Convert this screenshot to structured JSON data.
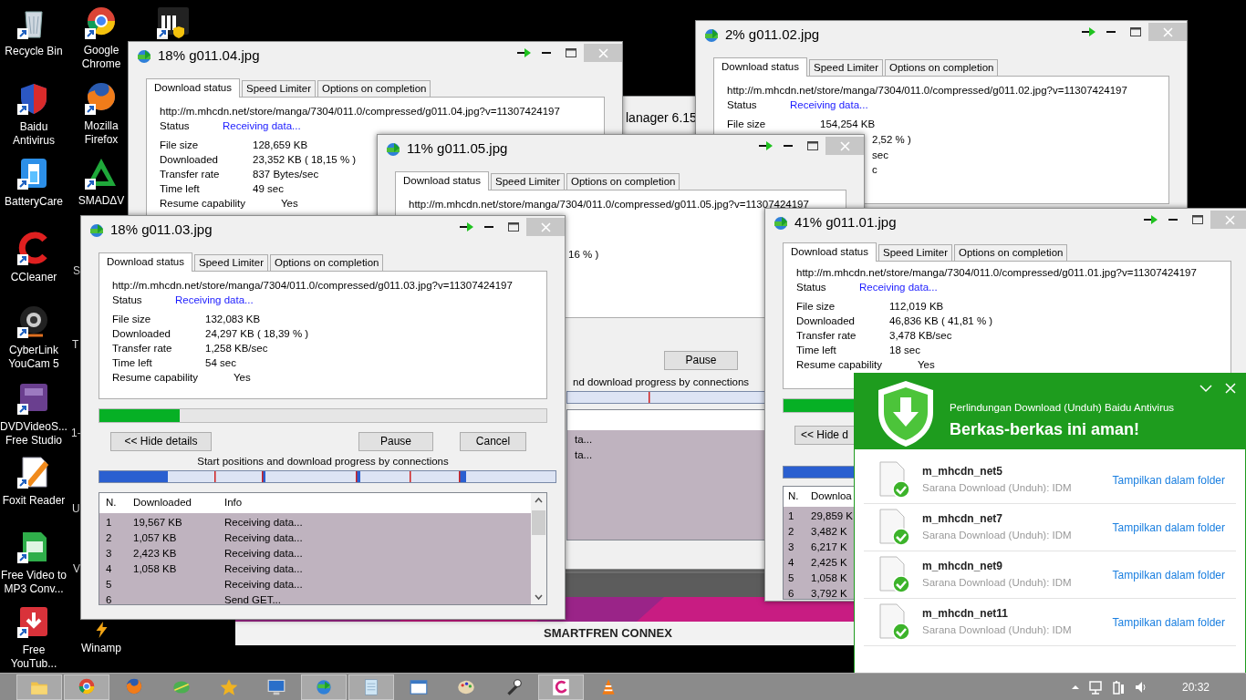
{
  "desktop_icons": [
    {
      "label": "Recycle Bin",
      "kind": "bin"
    },
    {
      "label": "Google Chrome",
      "kind": "chrome"
    },
    {
      "kind": "eop"
    },
    {
      "label": "Baidu Antivirus",
      "kind": "shield"
    },
    {
      "label": "Mozilla Firefox",
      "kind": "firefox"
    },
    {
      "label": "BatteryCare",
      "kind": "battery"
    },
    {
      "label": "SMADΔV",
      "kind": "triangle"
    },
    {
      "label": "CCleaner",
      "kind": "ccleaner"
    },
    {
      "label": "S",
      "kind": "partial"
    },
    {
      "label": "CyberLink YouCam 5",
      "kind": "webcam"
    },
    {
      "label": "T",
      "kind": "partial"
    },
    {
      "label": "DVDVideoS... Free Studio",
      "kind": "purple"
    },
    {
      "label": "1-",
      "kind": "partial"
    },
    {
      "label": "Foxit Reader",
      "kind": "pdf"
    },
    {
      "label": "U",
      "kind": "partial"
    },
    {
      "label": "Free Video to MP3 Conv...",
      "kind": "greendoc"
    },
    {
      "label": "V",
      "kind": "partial"
    },
    {
      "label": "Free YouTub...",
      "kind": "red"
    },
    {
      "label": "Winamp",
      "kind": "winamp"
    }
  ],
  "smartfren_window": {
    "title": "SMARTFREN CONNEX"
  },
  "background_window": {
    "title": "lanager 6.15"
  },
  "download_windows": [
    {
      "title": "18% g011.04.jpg",
      "tabs": [
        {
          "label": "Download status",
          "selected": true
        },
        {
          "label": "Speed Limiter",
          "selected": false
        },
        {
          "label": "Options on completion",
          "selected": false
        }
      ],
      "url": "http://m.mhcdn.net/store/manga/7304/011.0/compressed/g011.04.jpg?v=11307424197",
      "status": {
        "label": "Status",
        "value": "Receiving data..."
      },
      "details": [
        {
          "label": "File size",
          "value": "128,659 KB",
          "kind": "plain"
        },
        {
          "label": "Downloaded",
          "value": "23,352 KB ( 18,15 % )",
          "kind": "plain"
        },
        {
          "label": "Transfer rate",
          "value": "837 Bytes/sec",
          "kind": "plain"
        },
        {
          "label": "Time left",
          "value": "49 sec",
          "kind": "plain"
        },
        {
          "label": "Resume capability",
          "value": "Yes",
          "kind": "capability"
        }
      ]
    },
    {
      "title": "2% g011.02.jpg",
      "tabs": [
        {
          "label": "Download status",
          "selected": true
        },
        {
          "label": "Speed Limiter",
          "selected": false
        },
        {
          "label": "Options on completion",
          "selected": false
        }
      ],
      "url": "http://m.mhcdn.net/store/manga/7304/011.0/compressed/g011.02.jpg?v=11307424197",
      "status": {
        "label": "Status",
        "value": "Receiving data..."
      },
      "details": [
        {
          "label": "File size",
          "value": "154,254 KB",
          "kind": "plain"
        }
      ],
      "fragments": [
        {
          "kind": "value",
          "text": "2,52 % )"
        },
        {
          "kind": "value",
          "text": "sec"
        },
        {
          "kind": "value",
          "text": "c"
        }
      ]
    },
    {
      "title": "11% g011.05.jpg",
      "tabs": [
        {
          "label": "Download status",
          "selected": true
        },
        {
          "label": "Speed Limiter",
          "selected": false
        },
        {
          "label": "Options on completion",
          "selected": false
        }
      ],
      "url": "http://m.mhcdn.net/store/manga/7304/011.0/compressed/g011.05.jpg?v=11307424197",
      "fragments": [
        {
          "kind": "value",
          "text": "16 % )"
        },
        {
          "kind": "button",
          "text": "Pause"
        },
        {
          "kind": "caption",
          "text": "nd download progress by connections"
        },
        {
          "kind": "conn_bar"
        },
        {
          "kind": "list",
          "rows": [
            {
              "info": "ta..."
            },
            {
              "info": "ta..."
            }
          ]
        }
      ]
    },
    {
      "title": "18% g011.03.jpg",
      "tabs": [
        {
          "label": "Download status",
          "selected": true
        },
        {
          "label": "Speed Limiter",
          "selected": false
        },
        {
          "label": "Options on completion",
          "selected": false
        }
      ],
      "url": "http://m.mhcdn.net/store/manga/7304/011.0/compressed/g011.03.jpg?v=11307424197",
      "status": {
        "label": "Status",
        "value": "Receiving data..."
      },
      "details": [
        {
          "label": "File size",
          "value": "132,083 KB",
          "kind": "plain"
        },
        {
          "label": "Downloaded",
          "value": "24,297 KB ( 18,39 % )",
          "kind": "plain"
        },
        {
          "label": "Transfer rate",
          "value": "1,258 KB/sec",
          "kind": "plain"
        },
        {
          "label": "Time left",
          "value": "54 sec",
          "kind": "plain"
        },
        {
          "label": "Resume capability",
          "value": "Yes",
          "kind": "capability"
        }
      ],
      "progress": {
        "level": 0.18
      },
      "buttons": [
        "<< Hide details",
        "Pause",
        "Cancel"
      ],
      "caption": "Start positions and download progress by connections",
      "connections": {
        "columns": [
          "N.",
          "Downloaded",
          "Info"
        ],
        "rows": [
          {
            "n": "1",
            "downloaded": "19,567 KB",
            "info": "Receiving data..."
          },
          {
            "n": "2",
            "downloaded": "1,057 KB",
            "info": "Receiving data..."
          },
          {
            "n": "3",
            "downloaded": "2,423 KB",
            "info": "Receiving data..."
          },
          {
            "n": "4",
            "downloaded": "1,058 KB",
            "info": "Receiving data..."
          },
          {
            "n": "5",
            "info": "Receiving data..."
          },
          {
            "n": "6",
            "info": "Send GET..."
          }
        ]
      }
    },
    {
      "title": "41% g011.01.jpg",
      "tabs": [
        {
          "label": "Download status",
          "selected": true
        },
        {
          "label": "Speed Limiter",
          "selected": false
        },
        {
          "label": "Options on completion",
          "selected": false
        }
      ],
      "url": "http://m.mhcdn.net/store/manga/7304/011.0/compressed/g011.01.jpg?v=11307424197",
      "status": {
        "label": "Status",
        "value": "Receiving data..."
      },
      "details": [
        {
          "label": "File size",
          "value": "112,019 KB",
          "kind": "plain"
        },
        {
          "label": "Downloaded",
          "value": "46,836 KB ( 41,81 % )",
          "kind": "plain"
        },
        {
          "label": "Transfer rate",
          "value": "3,478 KB/sec",
          "kind": "plain"
        },
        {
          "label": "Time left",
          "value": "18 sec",
          "kind": "plain"
        },
        {
          "label": "Resume capability",
          "value": "Yes",
          "kind": "capability"
        }
      ],
      "progress": {
        "level": 0.41
      },
      "fragments": [
        {
          "kind": "button",
          "text": "<< Hide d"
        },
        {
          "kind": "conn_bar"
        },
        {
          "kind": "list",
          "columns": [
            "N.",
            "Downloa"
          ],
          "rows": [
            {
              "n": "1",
              "downloaded": "29,859 K"
            },
            {
              "n": "2",
              "downloaded": "3,482 K"
            },
            {
              "n": "3",
              "downloaded": "6,217 K"
            },
            {
              "n": "4",
              "downloaded": "2,425 K"
            },
            {
              "n": "5",
              "downloaded": "1,058 K"
            },
            {
              "n": "6",
              "downloaded": "3,792 K"
            }
          ]
        }
      ]
    }
  ],
  "notification": {
    "caption": "Perlindungan Download (Unduh) Baidu Antivirus",
    "headline": "Berkas-berkas ini aman!",
    "files": [
      {
        "name": "m_mhcdn_net5",
        "source": "Sarana Download (Unduh): IDM",
        "action": "Tampilkan dalam folder"
      },
      {
        "name": "m_mhcdn_net7",
        "source": "Sarana Download (Unduh): IDM",
        "action": "Tampilkan dalam folder"
      },
      {
        "name": "m_mhcdn_net9",
        "source": "Sarana Download (Unduh): IDM",
        "action": "Tampilkan dalam folder"
      },
      {
        "name": "m_mhcdn_net11",
        "source": "Sarana Download (Unduh): IDM",
        "action": "Tampilkan dalam folder"
      }
    ]
  },
  "taskbar": {
    "apps": [
      {
        "kind": "folder",
        "running": true
      },
      {
        "kind": "chrome",
        "running": true
      },
      {
        "kind": "firefox",
        "running": false
      },
      {
        "kind": "leaf",
        "running": false
      },
      {
        "kind": "star",
        "running": false
      },
      {
        "kind": "monitor",
        "running": false
      },
      {
        "kind": "idm",
        "running": true
      },
      {
        "kind": "notepad",
        "running": true
      },
      {
        "kind": "window",
        "running": false
      },
      {
        "kind": "palette",
        "running": false
      },
      {
        "kind": "tool",
        "running": false
      },
      {
        "kind": "swirl",
        "running": true
      },
      {
        "kind": "cone",
        "running": false
      }
    ],
    "clock": "20:32"
  }
}
